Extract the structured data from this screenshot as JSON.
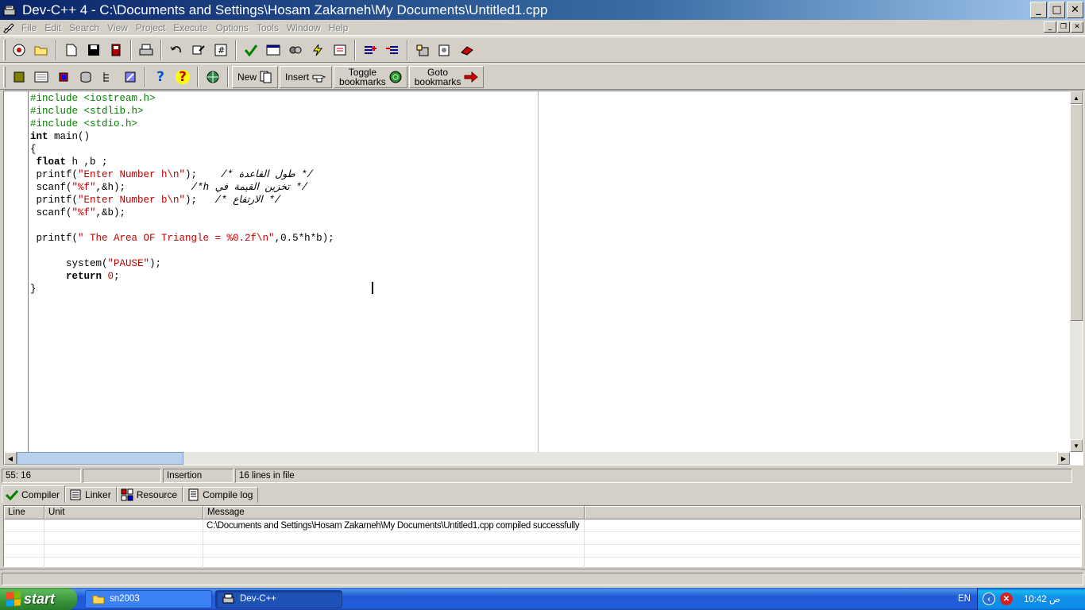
{
  "window": {
    "title": "Dev-C++ 4 - C:\\Documents and Settings\\Hosam Zakarneh\\My Documents\\Untitled1.cpp",
    "controls": {
      "minimize": "_",
      "maximize": "□",
      "close": "✕"
    }
  },
  "menu": {
    "items": [
      "File",
      "Edit",
      "Search",
      "View",
      "Project",
      "Execute",
      "Options",
      "Tools",
      "Window",
      "Help"
    ]
  },
  "toolbar2": {
    "new_label": "New",
    "insert_label": "Insert",
    "toggle_bookmarks_line1": "Toggle",
    "toggle_bookmarks_line2": "bookmarks",
    "goto_bookmarks_line1": "Goto",
    "goto_bookmarks_line2": "bookmarks"
  },
  "editor": {
    "lines": [
      [
        {
          "t": "#include <iostream.h>",
          "c": "pp"
        }
      ],
      [
        {
          "t": "#include <stdlib.h>",
          "c": "pp"
        }
      ],
      [
        {
          "t": "#include <stdio.h>",
          "c": "pp"
        }
      ],
      [
        {
          "t": "int",
          "c": "kw"
        },
        {
          "t": " main()",
          "c": ""
        }
      ],
      [
        {
          "t": "{",
          "c": ""
        }
      ],
      [
        {
          "t": " ",
          "c": ""
        },
        {
          "t": "float",
          "c": "kw"
        },
        {
          "t": " h ,b ;",
          "c": ""
        }
      ],
      [
        {
          "t": " printf(",
          "c": ""
        },
        {
          "t": "\"Enter Number h\\n\"",
          "c": "str"
        },
        {
          "t": ");    ",
          "c": ""
        },
        {
          "t": "/* طول القاعدة */",
          "c": "cm"
        }
      ],
      [
        {
          "t": " scanf(",
          "c": ""
        },
        {
          "t": "\"%f\"",
          "c": "str"
        },
        {
          "t": ",&h);           ",
          "c": ""
        },
        {
          "t": "/* تخزين القيمة في h*/",
          "c": "cm"
        }
      ],
      [
        {
          "t": " printf(",
          "c": ""
        },
        {
          "t": "\"Enter Number b\\n\"",
          "c": "str"
        },
        {
          "t": ");   ",
          "c": ""
        },
        {
          "t": "/* الارتفاع */",
          "c": "cm"
        }
      ],
      [
        {
          "t": " scanf(",
          "c": ""
        },
        {
          "t": "\"%f\"",
          "c": "str"
        },
        {
          "t": ",&b);",
          "c": ""
        }
      ],
      [
        {
          "t": "",
          "c": ""
        }
      ],
      [
        {
          "t": " printf(",
          "c": ""
        },
        {
          "t": "\" The Area OF Triangle = %0.2f\\n\"",
          "c": "str"
        },
        {
          "t": ",0.5*h*b);",
          "c": ""
        }
      ],
      [
        {
          "t": "",
          "c": ""
        }
      ],
      [
        {
          "t": "      system(",
          "c": ""
        },
        {
          "t": "\"PAUSE\"",
          "c": "str"
        },
        {
          "t": ");",
          "c": ""
        }
      ],
      [
        {
          "t": "      ",
          "c": ""
        },
        {
          "t": "return",
          "c": "kw"
        },
        {
          "t": " ",
          "c": ""
        },
        {
          "t": "0",
          "c": "str"
        },
        {
          "t": ";",
          "c": ""
        }
      ],
      [
        {
          "t": "}",
          "c": ""
        }
      ]
    ]
  },
  "status": {
    "position": "55: 16",
    "modified": "",
    "mode": "Insertion",
    "line_count": "16 lines in file"
  },
  "tabs": [
    "Compiler",
    "Linker",
    "Resource",
    "Compile log"
  ],
  "messages": {
    "headers": [
      "Line",
      "Unit",
      "Message"
    ],
    "rows": [
      {
        "line": "",
        "unit": "",
        "message": "C:\\Documents and Settings\\Hosam Zakarneh\\My Documents\\Untitled1.cpp compiled successfully"
      },
      {
        "line": "",
        "unit": "",
        "message": ""
      },
      {
        "line": "",
        "unit": "",
        "message": ""
      },
      {
        "line": "",
        "unit": "",
        "message": ""
      }
    ]
  },
  "taskbar": {
    "start_label": "start",
    "tasks": [
      "sn2003",
      "Dev-C++"
    ],
    "language": "EN",
    "clock": "10:42 ص"
  },
  "colors": {
    "title_bar": "#0a246a",
    "preprocessor": "#008000",
    "string": "#c00000",
    "taskbar": "#245edb",
    "start_button": "#389438"
  }
}
